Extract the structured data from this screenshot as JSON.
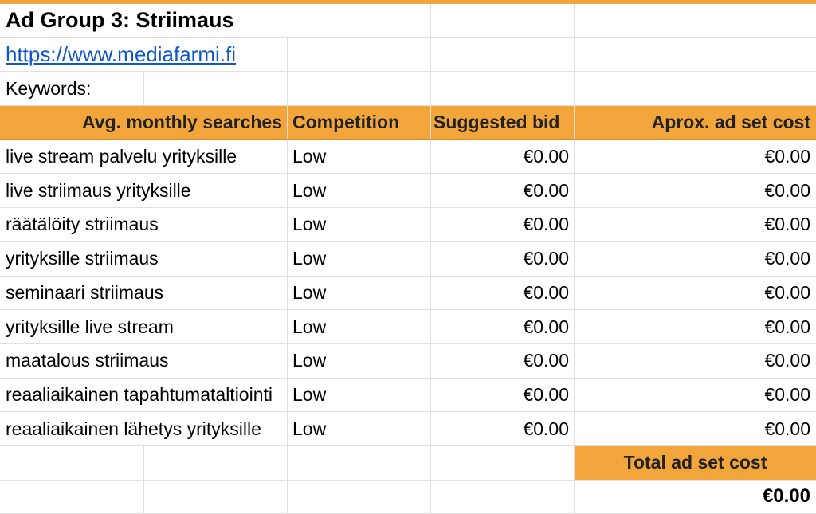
{
  "sheet": {
    "title": "Ad Group 3: Striimaus",
    "link": "https://www.mediafarmi.fi",
    "keywords_label": "Keywords:",
    "headers": {
      "searches": "Avg. monthly searches",
      "competition": "Competition",
      "bid": "Suggested bid",
      "cost": "Aprox. ad set cost"
    },
    "rows": [
      {
        "keyword": "live stream palvelu yrityksille",
        "competition": "Low",
        "bid": "€0.00",
        "cost": "€0.00"
      },
      {
        "keyword": "live striimaus yrityksille",
        "competition": "Low",
        "bid": "€0.00",
        "cost": "€0.00"
      },
      {
        "keyword": "räätälöity striimaus",
        "competition": "Low",
        "bid": "€0.00",
        "cost": "€0.00"
      },
      {
        "keyword": "yrityksille striimaus",
        "competition": "Low",
        "bid": "€0.00",
        "cost": "€0.00"
      },
      {
        "keyword": "seminaari striimaus",
        "competition": "Low",
        "bid": "€0.00",
        "cost": "€0.00"
      },
      {
        "keyword": "yrityksille live stream",
        "competition": "Low",
        "bid": "€0.00",
        "cost": "€0.00"
      },
      {
        "keyword": "maatalous striimaus",
        "competition": "Low",
        "bid": "€0.00",
        "cost": "€0.00"
      },
      {
        "keyword": "reaaliaikainen tapahtumataltiointi",
        "competition": "Low",
        "bid": "€0.00",
        "cost": "€0.00"
      },
      {
        "keyword": "reaaliaikainen lähetys yrityksille",
        "competition": "Low",
        "bid": "€0.00",
        "cost": "€0.00"
      }
    ],
    "total_label": "Total ad set cost",
    "total_value": "€0.00"
  },
  "colors": {
    "header_fill": "#f2a53b",
    "link": "#1155cc",
    "gridline": "#e0e0e0"
  }
}
